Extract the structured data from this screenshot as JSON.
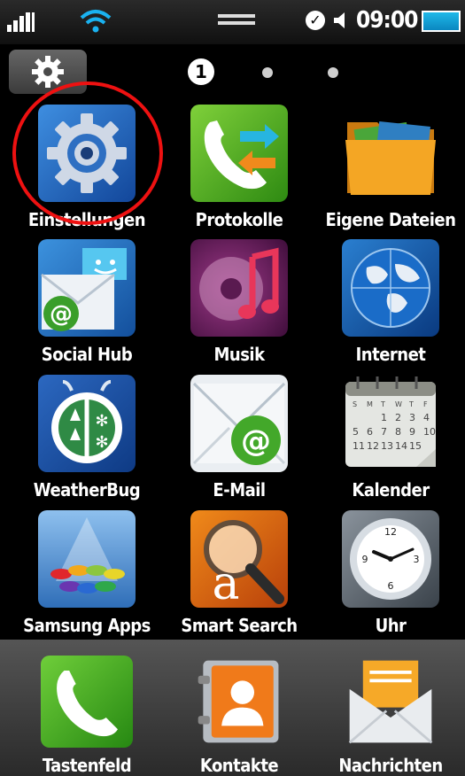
{
  "status": {
    "time": "09:00"
  },
  "pager": {
    "current": "1"
  },
  "apps": [
    {
      "label": "Einstellungen"
    },
    {
      "label": "Protokolle"
    },
    {
      "label": "Eigene Dateien"
    },
    {
      "label": "Social Hub"
    },
    {
      "label": "Musik"
    },
    {
      "label": "Internet"
    },
    {
      "label": "WeatherBug"
    },
    {
      "label": "E-Mail"
    },
    {
      "label": "Kalender"
    },
    {
      "label": "Samsung Apps"
    },
    {
      "label": "Smart Search"
    },
    {
      "label": "Uhr"
    }
  ],
  "dock": [
    {
      "label": "Tastenfeld"
    },
    {
      "label": "Kontakte"
    },
    {
      "label": "Nachrichten"
    }
  ],
  "calendar": {
    "weekdays": [
      "S",
      "M",
      "T",
      "W",
      "T",
      "F"
    ],
    "days": [
      "1",
      "2",
      "3",
      "4",
      "5",
      "6",
      "7",
      "8",
      "9",
      "10",
      "11",
      "12",
      "13",
      "14",
      "15"
    ]
  },
  "colors": {
    "highlight": "#e11111",
    "accent": "#1fb8e8"
  }
}
